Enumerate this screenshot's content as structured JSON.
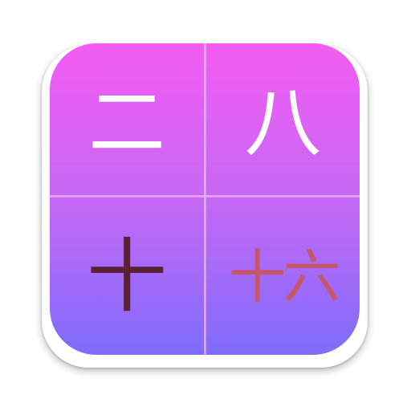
{
  "app_icon": {
    "cells": {
      "top_left": "二",
      "top_right": "八",
      "bottom_left": "十",
      "bottom_right": "十六"
    },
    "colors": {
      "gradient_top": "#f45cf3",
      "gradient_mid": "#c668f5",
      "gradient_bottom": "#7f6cfb",
      "divider": "#ebb4ff",
      "top_glyphs": "#ffffff",
      "bottom_left_glyph": "#5c1f38",
      "bottom_right_glyph": "#c8566a"
    }
  }
}
